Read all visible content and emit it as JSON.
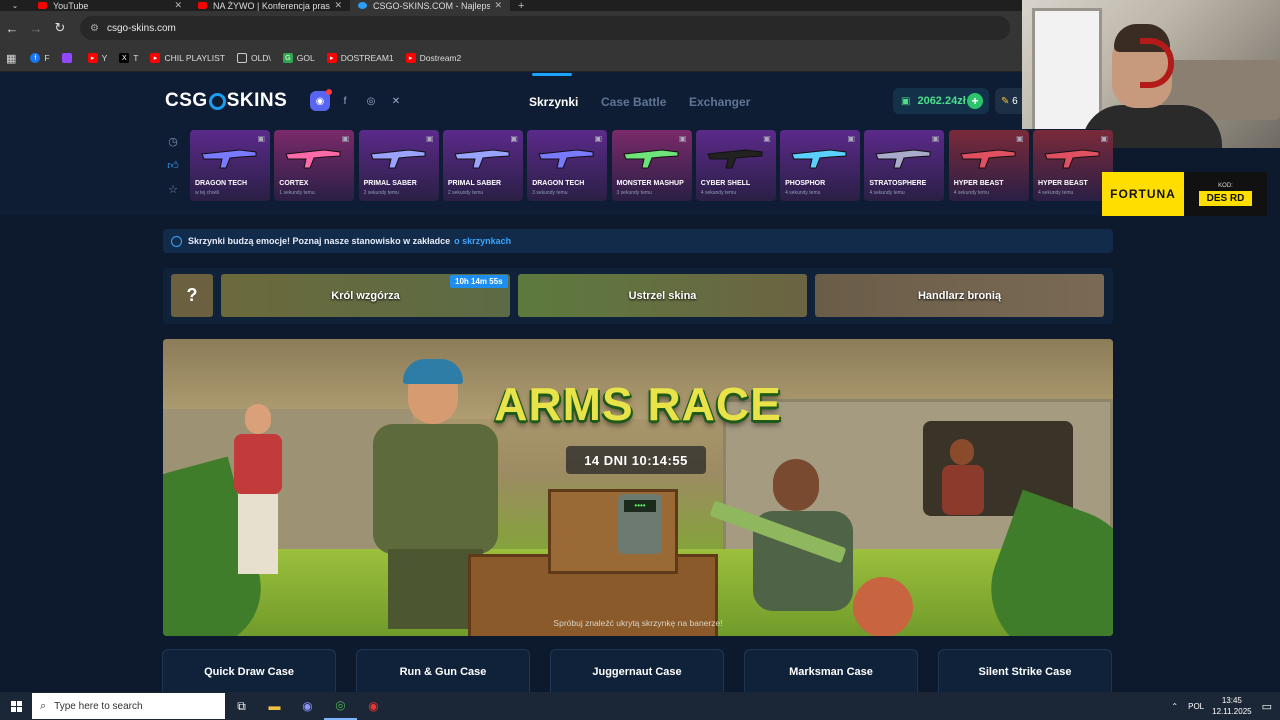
{
  "browser": {
    "tabs": [
      {
        "title": "YouTube",
        "favicon_color": "#ff0000",
        "active": false
      },
      {
        "title": "NA ŻYWO | Konferencja prasow",
        "favicon_color": "#ff0000",
        "active": false
      },
      {
        "title": "CSGO-SKINS.COM - Najlepsze",
        "favicon_color": "#2a9df4",
        "active": true
      }
    ],
    "url": "csgo-skins.com",
    "bookmarks": [
      {
        "label": "F",
        "icon": "facebook-icon",
        "color": "#1877f2"
      },
      {
        "label": "",
        "icon": "twitch-icon",
        "color": "#9146ff"
      },
      {
        "label": "Y",
        "icon": "youtube-icon",
        "color": "#ff0000"
      },
      {
        "label": "T",
        "icon": "x-icon",
        "color": "#000000"
      },
      {
        "label": "CHIL PLAYLIST",
        "icon": "youtube-icon",
        "color": "#ff0000"
      },
      {
        "label": "OLD\\",
        "icon": "folder-icon",
        "color": "#353535"
      },
      {
        "label": "GOL",
        "icon": "gol-icon",
        "color": "#2fa84f"
      },
      {
        "label": "DOSTREAM1",
        "icon": "youtube-icon",
        "color": "#ff0000"
      },
      {
        "label": "Dostream2",
        "icon": "youtube-icon",
        "color": "#ff0000"
      }
    ]
  },
  "overlay": {
    "sponsor": "FORTUNA",
    "code_label": "KOD:",
    "code_value": "DES RD"
  },
  "site": {
    "logo_left": "CSG",
    "logo_right": "SKINS",
    "nav": [
      "Skrzynki",
      "Case Battle",
      "Exchanger"
    ],
    "balance": "2062.24zł",
    "coins": "6",
    "accent": "#1aa3ff"
  },
  "drops": [
    {
      "name": "DRAGON TECH",
      "time": "w tej chwili",
      "rarity_color": "#5b2a8a"
    },
    {
      "name": "CORTEX",
      "time": "1 sekundy temu",
      "rarity_color": "#7a2a6a"
    },
    {
      "name": "PRIMAL SABER",
      "time": "2 sekundy temu",
      "rarity_color": "#5b2a8a"
    },
    {
      "name": "PRIMAL SABER",
      "time": "2 sekundy temu",
      "rarity_color": "#5b2a8a"
    },
    {
      "name": "DRAGON TECH",
      "time": "3 sekundy temu",
      "rarity_color": "#5b2a8a"
    },
    {
      "name": "MONSTER MASHUP",
      "time": "3 sekundy temu",
      "rarity_color": "#7a2a6a"
    },
    {
      "name": "CYBER SHELL",
      "time": "4 sekundy temu",
      "rarity_color": "#5b2a8a"
    },
    {
      "name": "PHOSPHOR",
      "time": "4 sekundy temu",
      "rarity_color": "#5b2a8a"
    },
    {
      "name": "STRATOSPHERE",
      "time": "4 sekundy temu",
      "rarity_color": "#5b2a8a"
    },
    {
      "name": "HYPER BEAST",
      "time": "4 sekundy temu",
      "rarity_color": "#7a2a3a"
    },
    {
      "name": "HYPER BEAST",
      "time": "4 sekundy temu",
      "rarity_color": "#7a2a3a"
    }
  ],
  "info": {
    "text": "Skrzynki budzą emocje! Poznaj nasze stanowisko w zakładce",
    "link": "o skrzynkach"
  },
  "events": {
    "mystery": "?",
    "timer": "10h 14m 55s",
    "items": [
      "Król wzgórza",
      "Ustrzel skina",
      "Handlarz bronią"
    ]
  },
  "hero": {
    "title": "ARMS RACE",
    "countdown": "14 DNI 10:14:55",
    "keypad": "••••",
    "hint": "Spróbuj znaleźć ukrytą skrzynkę na banerze!"
  },
  "cases": [
    "Quick Draw Case",
    "Run & Gun Case",
    "Juggernaut Case",
    "Marksman Case",
    "Silent Strike Case"
  ],
  "taskbar": {
    "search_placeholder": "Type here to search",
    "lang": "POL",
    "time": "13:45",
    "date": "12.11.2025"
  }
}
